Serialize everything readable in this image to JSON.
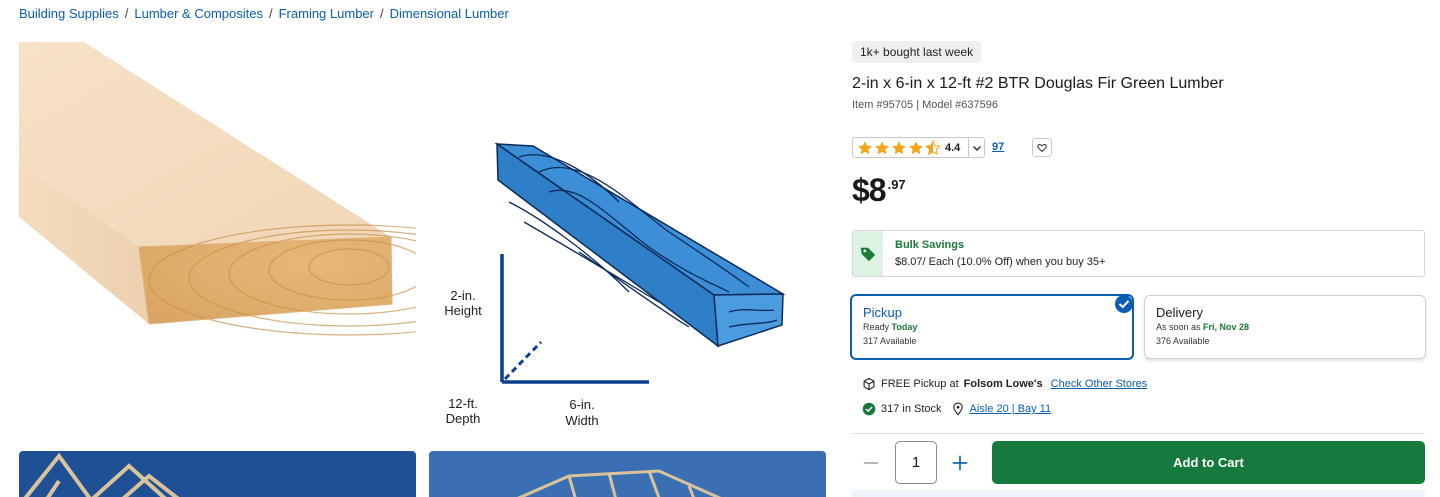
{
  "breadcrumb": [
    {
      "label": "Building Supplies"
    },
    {
      "label": "Lumber & Composites"
    },
    {
      "label": "Framing Lumber"
    },
    {
      "label": "Dimensional Lumber"
    }
  ],
  "breadcrumb_separator": "/",
  "gallery": {
    "diagram": {
      "height_label": "2-in.",
      "height_caption": "Height",
      "depth_label": "12-ft.",
      "depth_caption": "Depth",
      "width_label": "6-in.",
      "width_caption": "Width"
    }
  },
  "product": {
    "badge": "1k+ bought last week",
    "title": "2-in x 6-in x 12-ft #2 BTR Douglas Fir Green Lumber",
    "item_meta": "Item #95705 | Model #637596",
    "rating": {
      "value": "4.4",
      "stars_fraction": 0.88,
      "review_count": "97"
    },
    "price": {
      "dollars": "$8",
      "cents": ".97"
    },
    "bulk": {
      "title": "Bulk Savings",
      "description": "$8.07/ Each (10.0% Off) when you buy 35+"
    }
  },
  "fulfillment": {
    "pickup": {
      "title": "Pickup",
      "ready_prefix": "Ready",
      "ready_day": "Today",
      "available": "317 Available"
    },
    "delivery": {
      "title": "Delivery",
      "eta_prefix": "As soon as",
      "eta_day": "Fri, Nov 28",
      "available": "376 Available"
    }
  },
  "store": {
    "pickup_text": "FREE Pickup at",
    "store_name": "Folsom Lowe's",
    "check_other": "Check Other Stores",
    "stock_text": "317 in Stock",
    "aisle": "Aisle 20 | Bay 11"
  },
  "cart": {
    "quantity": "1",
    "add_label": "Add to Cart"
  },
  "colors": {
    "accent_blue": "#0b5db3",
    "cart_green": "#167a3d",
    "star": "#f2a516"
  }
}
